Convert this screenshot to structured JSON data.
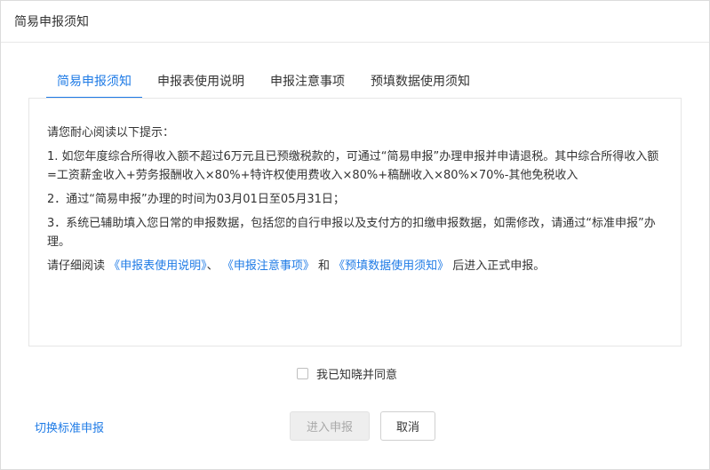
{
  "dialog": {
    "title": "简易申报须知"
  },
  "tabs": [
    {
      "label": "简易申报须知",
      "active": true
    },
    {
      "label": "申报表使用说明",
      "active": false
    },
    {
      "label": "申报注意事项",
      "active": false
    },
    {
      "label": "预填数据使用须知",
      "active": false
    }
  ],
  "content": {
    "heading": "请您耐心阅读以下提示：",
    "item1": "1. 如您年度综合所得收入额不超过6万元且已预缴税款的，可通过“简易申报”办理申报并申请退税。其中综合所得收入额=工资薪金收入+劳务报酬收入×80%+特许权使用费收入×80%+稿酬收入×80%×70%-其他免税收入",
    "item2": "2．通过“简易申报”办理的时间为03月01日至05月31日；",
    "item3": "3．系统已辅助填入您日常的申报数据，包括您的自行申报以及支付方的扣缴申报数据，如需修改，请通过“标准申报”办理。",
    "read_prefix": "请仔细阅读",
    "link1": "《申报表使用说明》",
    "sep1": "、",
    "link2": "《申报注意事项》",
    "sep2": "和",
    "link3": "《预填数据使用须知》",
    "read_suffix": "后进入正式申报。"
  },
  "agreement": {
    "label": "我已知晓并同意",
    "checked": false
  },
  "footer": {
    "switch_label": "切换标准申报",
    "submit_label": "进入申报",
    "cancel_label": "取消"
  }
}
